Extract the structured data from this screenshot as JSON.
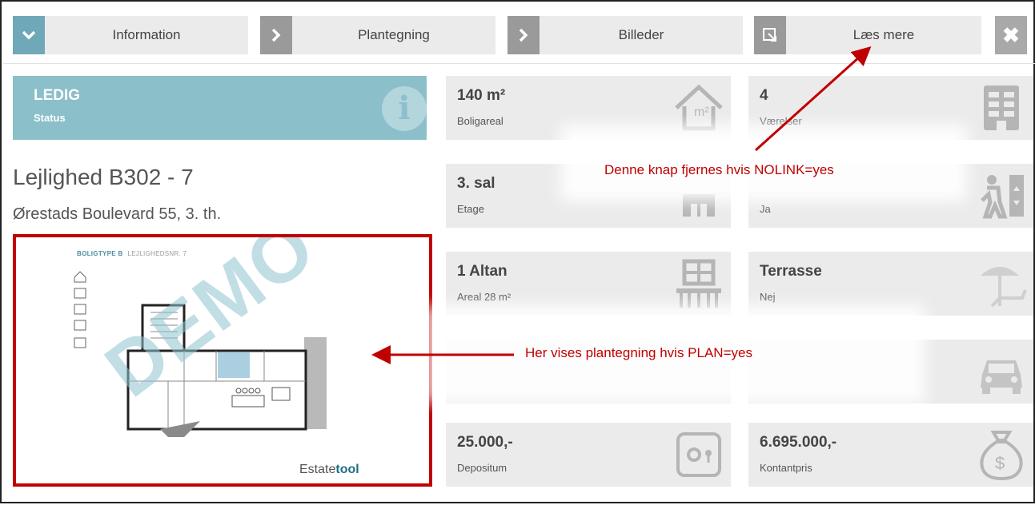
{
  "tabs": {
    "info": "Information",
    "plan": "Plantegning",
    "pics": "Billeder",
    "more": "Læs mere"
  },
  "status": {
    "title": "LEDIG",
    "subtitle": "Status"
  },
  "apartment": {
    "name": "Lejlighed B302 - 7",
    "address": "Ørestads Boulevard 55, 3. th."
  },
  "plan": {
    "header_type": "BOLIGTYPE B",
    "header_no": "LEJLIGHEDSNR. 7",
    "watermark": "DEMO",
    "brand_a": "Estate",
    "brand_b": "tool"
  },
  "cards": [
    {
      "value": "140 m²",
      "label": "Boligareal",
      "icon": "house-area-icon"
    },
    {
      "value": "4",
      "label": "Værelser",
      "icon": "building-icon"
    },
    {
      "value": "3. sal",
      "label": "Etage",
      "icon": "floor-icon"
    },
    {
      "value": "",
      "label": "Ja",
      "icon": "elevator-icon"
    },
    {
      "value": "1 Altan",
      "label": "Areal 28 m²",
      "icon": "balcony-icon"
    },
    {
      "value": "Terrasse",
      "label": "Nej",
      "icon": "terrace-icon"
    },
    {
      "value": "",
      "label": "",
      "icon": "car-icon"
    },
    {
      "value": "25.000,-",
      "label": "Depositum",
      "icon": "safe-icon"
    },
    {
      "value": "6.695.000,-",
      "label": "Kontantpris",
      "icon": "money-bag-icon"
    }
  ],
  "annotations": {
    "nolink": "Denne knap fjernes hvis NOLINK=yes",
    "plan": "Her vises plantegning hvis PLAN=yes"
  },
  "colors": {
    "accent": "#8bbfca",
    "annotation": "#c00000"
  }
}
